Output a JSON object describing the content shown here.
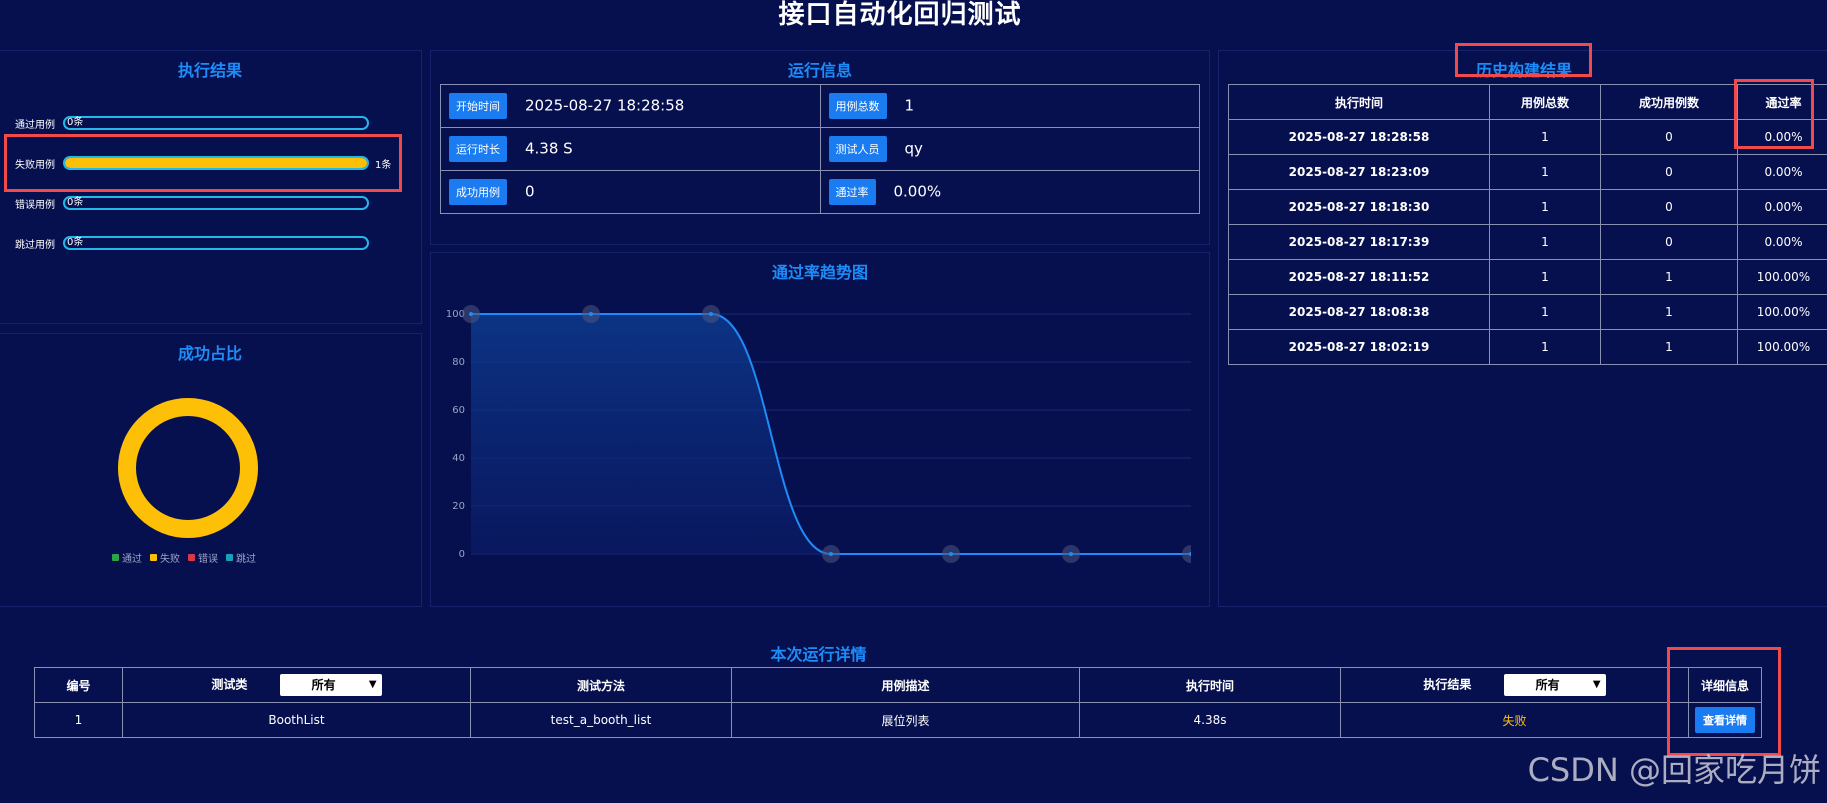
{
  "page": {
    "title": "接口自动化回归测试"
  },
  "results_panel": {
    "title": "执行结果",
    "rows": [
      {
        "label": "通过用例",
        "count": "0条",
        "fill_percent": 0
      },
      {
        "label": "失败用例",
        "count": "1条",
        "fill_percent": 100
      },
      {
        "label": "错误用例",
        "count": "0条",
        "fill_percent": 0
      },
      {
        "label": "跳过用例",
        "count": "0条",
        "fill_percent": 0
      }
    ]
  },
  "success_panel": {
    "title": "成功占比",
    "legend": [
      {
        "label": "通过",
        "color": "#28a745"
      },
      {
        "label": "失败",
        "color": "#fec007"
      },
      {
        "label": "错误",
        "color": "#dc3545"
      },
      {
        "label": "跳过",
        "color": "#17a2b8"
      }
    ],
    "slices": {
      "通过": 0,
      "失败": 1,
      "错误": 0,
      "跳过": 0
    }
  },
  "run_info": {
    "title": "运行信息",
    "start_time_label": "开始时间",
    "start_time": "2025-08-27 18:28:58",
    "total_label": "用例总数",
    "total": "1",
    "duration_label": "运行时长",
    "duration": "4.38 S",
    "tester_label": "测试人员",
    "tester": "qy",
    "success_label": "成功用例",
    "success": "0",
    "pass_rate_label": "通过率",
    "pass_rate": "0.00%"
  },
  "trend": {
    "title": "通过率趋势图"
  },
  "chart_data": {
    "type": "line",
    "title": "通过率趋势图",
    "x": [
      1,
      2,
      3,
      4,
      5,
      6,
      7
    ],
    "series": [
      {
        "values": [
          100,
          100,
          100,
          0,
          0,
          0,
          0
        ]
      }
    ],
    "ylim": [
      0,
      100
    ],
    "yticks": [
      0,
      20,
      40,
      60,
      80,
      100
    ],
    "grid": true,
    "xlabel": "",
    "ylabel": ""
  },
  "history": {
    "title": "历史构建结果",
    "headers": [
      "执行时间",
      "用例总数",
      "成功用例数",
      "通过率"
    ],
    "rows": [
      [
        "2025-08-27 18:28:58",
        "1",
        "0",
        "0.00%"
      ],
      [
        "2025-08-27 18:23:09",
        "1",
        "0",
        "0.00%"
      ],
      [
        "2025-08-27 18:18:30",
        "1",
        "0",
        "0.00%"
      ],
      [
        "2025-08-27 18:17:39",
        "1",
        "0",
        "0.00%"
      ],
      [
        "2025-08-27 18:11:52",
        "1",
        "1",
        "100.00%"
      ],
      [
        "2025-08-27 18:08:38",
        "1",
        "1",
        "100.00%"
      ],
      [
        "2025-08-27 18:02:19",
        "1",
        "1",
        "100.00%"
      ]
    ]
  },
  "details": {
    "title": "本次运行详情",
    "headers": {
      "id": "编号",
      "class": "测试类",
      "method": "测试方法",
      "desc": "用例描述",
      "time": "执行时间",
      "result": "执行结果",
      "info": "详细信息"
    },
    "class_filter": "所有",
    "result_filter": "所有",
    "rows": [
      {
        "id": "1",
        "class": "BoothList",
        "method": "test_a_booth_list",
        "desc": "展位列表",
        "time": "4.38s",
        "result": "失败",
        "action": "查看详情"
      }
    ]
  },
  "watermark": "CSDN @回家吃月饼"
}
